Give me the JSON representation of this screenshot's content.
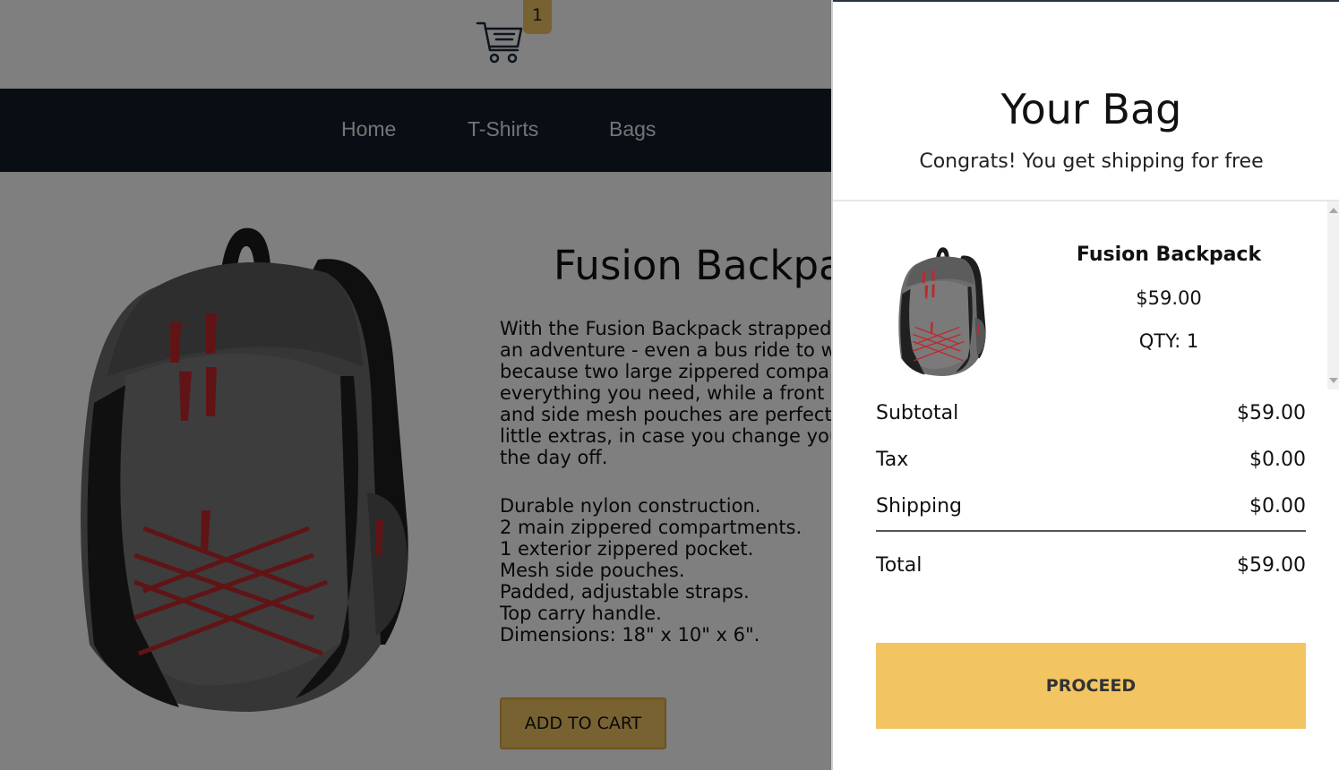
{
  "header": {
    "cart_count": "1"
  },
  "nav": {
    "items": [
      {
        "label": "Home"
      },
      {
        "label": "T-Shirts"
      },
      {
        "label": "Bags"
      }
    ]
  },
  "product": {
    "title": "Fusion Backpack",
    "description_lines": [
      "With the Fusion Backpack strapped",
      "an adventure - even a bus ride to w",
      "because two large zippered compa",
      "everything you need, while a front z",
      "and side mesh pouches are perfect",
      "little extras, in case you change you",
      "the day off."
    ],
    "features": [
      "Durable nylon construction.",
      "2 main zippered compartments.",
      "1 exterior zippered pocket.",
      "Mesh side pouches.",
      "Padded, adjustable straps.",
      "Top carry handle.",
      "Dimensions: 18\" x 10\" x 6\"."
    ],
    "add_to_cart_label": "ADD TO CART"
  },
  "cart": {
    "title": "Your Bag",
    "subtitle": "Congrats! You get shipping for free",
    "items": [
      {
        "name": "Fusion Backpack",
        "price": "$59.00",
        "qty": "QTY: 1"
      }
    ],
    "summary": {
      "subtotal_label": "Subtotal",
      "subtotal": "$59.00",
      "tax_label": "Tax",
      "tax": "$0.00",
      "shipping_label": "Shipping",
      "shipping": "$0.00",
      "total_label": "Total",
      "total": "$59.00"
    },
    "proceed_label": "PROCEED"
  },
  "colors": {
    "accent": "#f2c562",
    "nav_bg": "#131d2b"
  }
}
